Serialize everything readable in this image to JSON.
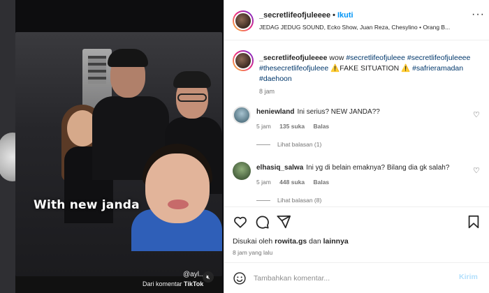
{
  "media": {
    "overlay_caption": "With new janda",
    "handle": "@ayl...",
    "footer_text": "Dari komentar",
    "footer_brand": "TikTok",
    "mute_icon": "speaker-muted-icon"
  },
  "header": {
    "username": "_secretlifeofjuleeee",
    "follow_label": "Ikuti",
    "audio": "JEDAG JEDUG SOUND, Ecko Show, Juan Reza, Chesylino • Orang B..."
  },
  "caption": {
    "username": "_secretlifeofjuleeee",
    "text_1": "wow",
    "tags_1": "#secretlifeofjuleee #secretlifeofjuleeee #thesecretlifeofjuleee",
    "warning_icon": "⚠️",
    "text_2": "FAKE SITUATION",
    "warning_icon_2": "⚠️",
    "tags_2": "#safrieramadan #daehoon",
    "time": "8 jam"
  },
  "comments": [
    {
      "username": "heniewland",
      "text": "Ini serius? NEW JANDA??",
      "time": "5 jam",
      "likes": "135 suka",
      "reply_label": "Balas",
      "replies_label": "Lihat balasan (1)"
    },
    {
      "username": "elhasiq_salwa",
      "text": "Ini yg di belain emaknya? Bilang dia gk salah?",
      "time": "5 jam",
      "likes": "448 suka",
      "reply_label": "Balas",
      "replies_label": "Lihat balasan (8)"
    }
  ],
  "likes_line": {
    "prefix": "Disukai oleh",
    "user": "rowita.gs",
    "middle": "dan",
    "suffix": "lainnya"
  },
  "posted": "8 jam yang lalu",
  "add_comment": {
    "placeholder": "Tambahkan komentar...",
    "post_label": "Kirim"
  },
  "colors": {
    "accent": "#0095f6",
    "hashtag": "#00376b",
    "muted": "#737373",
    "post_disabled": "#b2dffc"
  }
}
